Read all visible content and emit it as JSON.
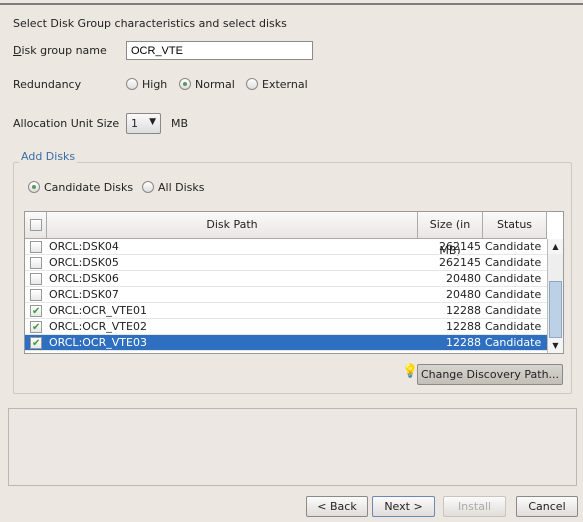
{
  "header": {
    "title": "Select Disk Group characteristics and select disks"
  },
  "form": {
    "disk_group_label": "Disk group name",
    "disk_group_value": "OCR_VTE",
    "redundancy_label": "Redundancy",
    "redundancy_options": [
      "High",
      "Normal",
      "External"
    ],
    "redundancy_selected": "Normal",
    "au_label": "Allocation Unit Size",
    "au_value": "1",
    "au_unit": "MB"
  },
  "add_disks": {
    "title": "Add Disks",
    "filter_options": [
      "Candidate Disks",
      "All Disks"
    ],
    "filter_selected": "Candidate Disks",
    "columns": [
      "Disk Path",
      "Size (in MB)",
      "Status"
    ],
    "rows": [
      {
        "checked": false,
        "path": "ORCL:DSK04",
        "size": "262145",
        "status": "Candidate"
      },
      {
        "checked": false,
        "path": "ORCL:DSK05",
        "size": "262145",
        "status": "Candidate"
      },
      {
        "checked": false,
        "path": "ORCL:DSK06",
        "size": "20480",
        "status": "Candidate"
      },
      {
        "checked": false,
        "path": "ORCL:DSK07",
        "size": "20480",
        "status": "Candidate"
      },
      {
        "checked": true,
        "path": "ORCL:OCR_VTE01",
        "size": "12288",
        "status": "Candidate"
      },
      {
        "checked": true,
        "path": "ORCL:OCR_VTE02",
        "size": "12288",
        "status": "Candidate"
      },
      {
        "checked": true,
        "path": "ORCL:OCR_VTE03",
        "size": "12288",
        "status": "Candidate",
        "selected": true
      }
    ],
    "change_discovery_label": "Change Discovery Path..."
  },
  "footer": {
    "back": "< Back",
    "next": "Next >",
    "install": "Install",
    "cancel": "Cancel"
  },
  "colors": {
    "selection": "#2f6fc0",
    "group_title": "#3a6ea5",
    "background": "#ede7e1"
  },
  "icons": {
    "hint": "lightbulb-icon"
  }
}
